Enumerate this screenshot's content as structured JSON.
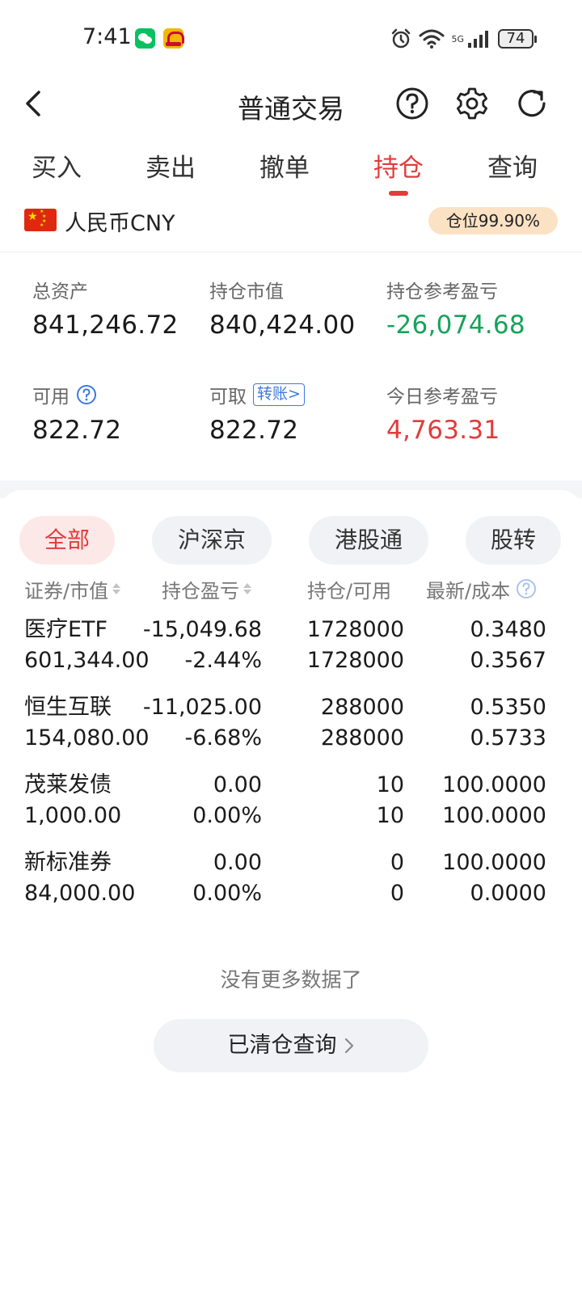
{
  "status_bar": {
    "time": "7:41",
    "battery": "74",
    "network": "5G",
    "icons": [
      "wechat-icon",
      "app-notification-icon",
      "alarm-icon",
      "wifi-icon",
      "signal-icon",
      "battery-icon"
    ]
  },
  "header": {
    "title": "普通交易",
    "icons": [
      "back-icon",
      "help-icon",
      "settings-icon",
      "refresh-icon"
    ]
  },
  "tabs": [
    {
      "label": "买入",
      "active": false
    },
    {
      "label": "卖出",
      "active": false
    },
    {
      "label": "撤单",
      "active": false
    },
    {
      "label": "持仓",
      "active": true
    },
    {
      "label": "查询",
      "active": false
    }
  ],
  "currency": {
    "label": "人民币CNY",
    "flag": "china-flag-icon",
    "position_badge": "仓位99.90%"
  },
  "summary": {
    "total_assets": {
      "label": "总资产",
      "value": "841,246.72"
    },
    "market_value": {
      "label": "持仓市值",
      "value": "840,424.00"
    },
    "position_pnl": {
      "label": "持仓参考盈亏",
      "value": "-26,074.68"
    },
    "available": {
      "label": "可用",
      "value": "822.72"
    },
    "withdrawable": {
      "label": "可取",
      "value": "822.72",
      "link": "转账>"
    },
    "today_pnl": {
      "label": "今日参考盈亏",
      "value": "4,763.31"
    }
  },
  "filters": [
    {
      "label": "全部",
      "active": true
    },
    {
      "label": "沪深京",
      "active": false
    },
    {
      "label": "港股通",
      "active": false
    },
    {
      "label": "股转",
      "active": false
    }
  ],
  "columns": {
    "security": "证券/市值",
    "pnl": "持仓盈亏",
    "position": "持仓/可用",
    "latest": "最新/成本"
  },
  "holdings": [
    {
      "name": "医疗ETF",
      "market_value": "601,344.00",
      "pnl": "-15,049.68",
      "pnl_pct": "-2.44%",
      "position": "1728000",
      "available": "1728000",
      "latest": "0.3480",
      "cost": "0.3567",
      "negative": true
    },
    {
      "name": "恒生互联",
      "market_value": "154,080.00",
      "pnl": "-11,025.00",
      "pnl_pct": "-6.68%",
      "position": "288000",
      "available": "288000",
      "latest": "0.5350",
      "cost": "0.5733",
      "negative": true
    },
    {
      "name": "茂莱发债",
      "market_value": "1,000.00",
      "pnl": "0.00",
      "pnl_pct": "0.00%",
      "position": "10",
      "available": "10",
      "latest": "100.0000",
      "cost": "100.0000",
      "negative": false
    },
    {
      "name": "新标准券",
      "market_value": "84,000.00",
      "pnl": "0.00",
      "pnl_pct": "0.00%",
      "position": "0",
      "available": "0",
      "latest": "100.0000",
      "cost": "0.0000",
      "negative": false
    }
  ],
  "footer": {
    "no_more": "没有更多数据了",
    "cleared_button": "已清仓查询"
  },
  "colors": {
    "accent_red": "#e03c3c",
    "loss_green": "#16a35a",
    "badge_bg": "#fce2c4",
    "link_blue": "#3b7ae0"
  }
}
